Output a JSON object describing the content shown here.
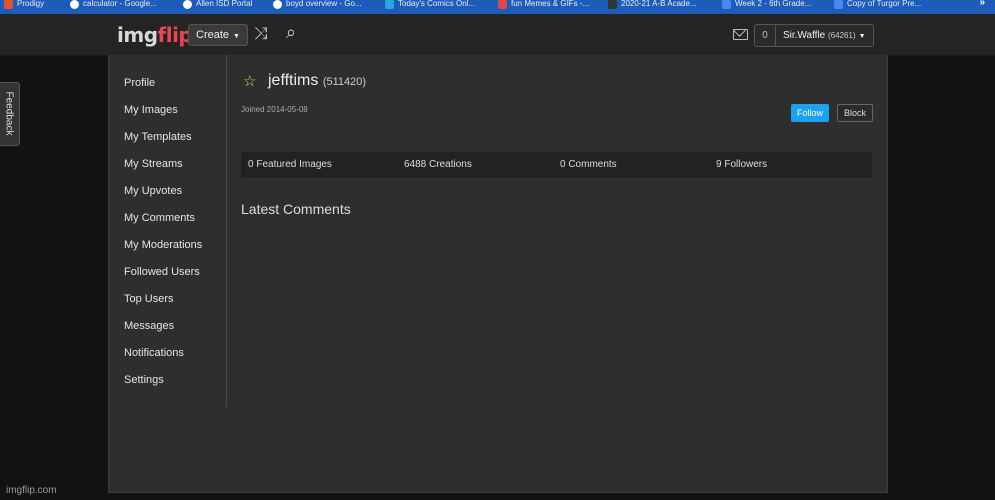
{
  "bookmarks": [
    {
      "label": "Prodigy",
      "color": "#e0552f"
    },
    {
      "label": "calculator - Google...",
      "color": "#ffffff"
    },
    {
      "label": "Allen ISD Portal",
      "color": "#ffffff"
    },
    {
      "label": "boyd overview - Go...",
      "color": "#ffffff"
    },
    {
      "label": "Today's Comics Onl...",
      "color": "#2aa6e0"
    },
    {
      "label": "fun Memes & GIFs -...",
      "color": "#e04848"
    },
    {
      "label": "2020-21 A-B Acade...",
      "color": "#333333"
    },
    {
      "label": "Week 2 - 6th Grade...",
      "color": "#4a8af0"
    },
    {
      "label": "Copy of Turgor Pre...",
      "color": "#4a8af0"
    }
  ],
  "bookmarks_more": "»",
  "header": {
    "logo_img": "img",
    "logo_flip": "flip",
    "create_label": "Create",
    "create_caret": "▼",
    "shuffle_icon": "⤨",
    "search_icon": "⌕",
    "notification_count": "0",
    "user_name": "Sir.Waffle",
    "user_points": "(64261)",
    "user_caret": "▼"
  },
  "feedback_label": "Feedback",
  "sidebar": {
    "items": [
      {
        "label": "Profile"
      },
      {
        "label": "My Images"
      },
      {
        "label": "My Templates"
      },
      {
        "label": "My Streams"
      },
      {
        "label": "My Upvotes"
      },
      {
        "label": "My Comments"
      },
      {
        "label": "My Moderations"
      },
      {
        "label": "Followed Users"
      },
      {
        "label": "Top Users"
      },
      {
        "label": "Messages"
      },
      {
        "label": "Notifications"
      },
      {
        "label": "Settings"
      }
    ]
  },
  "profile": {
    "star": "☆",
    "username": "jefftims",
    "points": "(511420)",
    "joined": "Joined 2014-05-08",
    "follow_label": "Follow",
    "block_label": "Block"
  },
  "stats": {
    "featured": "0 Featured Images",
    "creations": "6488 Creations",
    "comments": "0 Comments",
    "followers": "9 Followers"
  },
  "latest_comments_heading": "Latest Comments",
  "watermark": "imgflip.com",
  "colors": {
    "bookmarks_bar": "#1d5cb8",
    "header_bg": "#242424",
    "panel_bg": "#2e2e2e",
    "follow_blue": "#1da1f2",
    "logo_red": "#e8474e"
  }
}
